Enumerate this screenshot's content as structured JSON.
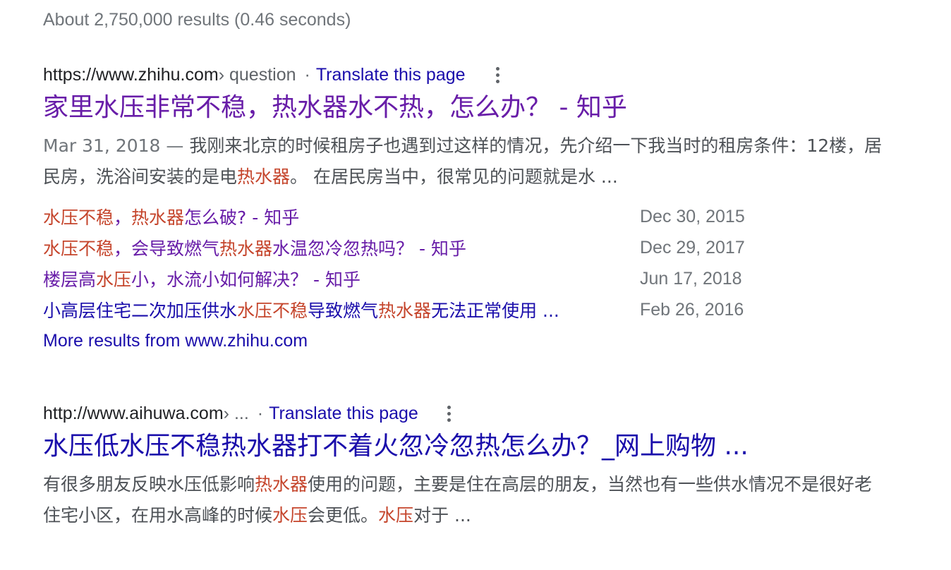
{
  "stats": "About 2,750,000 results (0.46 seconds)",
  "colors": {
    "link": "#1a0dab",
    "visited": "#681da8",
    "highlight": "#c5452c",
    "meta": "#70757a",
    "snippet": "#4d5156"
  },
  "results": [
    {
      "domain": "https://www.zhihu.com",
      "path": " › question",
      "separator": "·",
      "translate": "Translate this page",
      "menu_icon": "more-vert-icon",
      "title": "家里水压非常不稳，热水器水不热，怎么办？ - 知乎",
      "snippet_date": "Mar 31, 2018 — ",
      "snippet": [
        {
          "t": "我刚来北京的时候租房子也遇到过这样的情况，先介绍一下我当时的租房条件：12楼，居民房，洗浴间安装的是电",
          "h": false
        },
        {
          "t": "热水器",
          "h": true
        },
        {
          "t": "。 在居民房当中，很常见的问题就是水 ...",
          "h": false
        }
      ],
      "sitelinks": [
        {
          "visited": true,
          "parts": [
            {
              "t": "水压不稳",
              "h": true
            },
            {
              "t": "，",
              "h": false
            },
            {
              "t": "热水器",
              "h": true
            },
            {
              "t": "怎么破? - 知乎",
              "h": false
            }
          ],
          "date": "Dec 30, 2015"
        },
        {
          "visited": true,
          "parts": [
            {
              "t": "水压不稳",
              "h": true
            },
            {
              "t": "，会导致燃气",
              "h": false
            },
            {
              "t": "热水器",
              "h": true
            },
            {
              "t": "水温忽冷忽热吗？ - 知乎",
              "h": false
            }
          ],
          "date": "Dec 29, 2017"
        },
        {
          "visited": true,
          "parts": [
            {
              "t": "楼层高",
              "h": false
            },
            {
              "t": "水压",
              "h": true
            },
            {
              "t": "小，水流小如何解决？ - 知乎",
              "h": false
            }
          ],
          "date": "Jun 17, 2018"
        },
        {
          "visited": false,
          "parts": [
            {
              "t": "小高层住宅二次加压供水",
              "h": false
            },
            {
              "t": "水压不稳",
              "h": true
            },
            {
              "t": "导致燃气",
              "h": false
            },
            {
              "t": "热水器",
              "h": true
            },
            {
              "t": "无法正常使用 ...",
              "h": false
            }
          ],
          "date": "Feb 26, 2016"
        }
      ],
      "more_results": "More results from www.zhihu.com"
    },
    {
      "domain": "http://www.aihuwa.com",
      "path": " › ...",
      "separator": "·",
      "translate": "Translate this page",
      "menu_icon": "more-vert-icon",
      "title": "水压低水压不稳热水器打不着火忽冷忽热怎么办？_网上购物 ...",
      "snippet_date": "",
      "snippet": [
        {
          "t": "有很多朋友反映水压低影响",
          "h": false
        },
        {
          "t": "热水器",
          "h": true
        },
        {
          "t": "使用的问题，主要是住在高层的朋友，当然也有一些供水情况不是很好老住宅小区，在用水高峰的时候",
          "h": false
        },
        {
          "t": "水压",
          "h": true
        },
        {
          "t": "会更低。",
          "h": false
        },
        {
          "t": "水压",
          "h": true
        },
        {
          "t": "对于 ...",
          "h": false
        }
      ]
    }
  ]
}
